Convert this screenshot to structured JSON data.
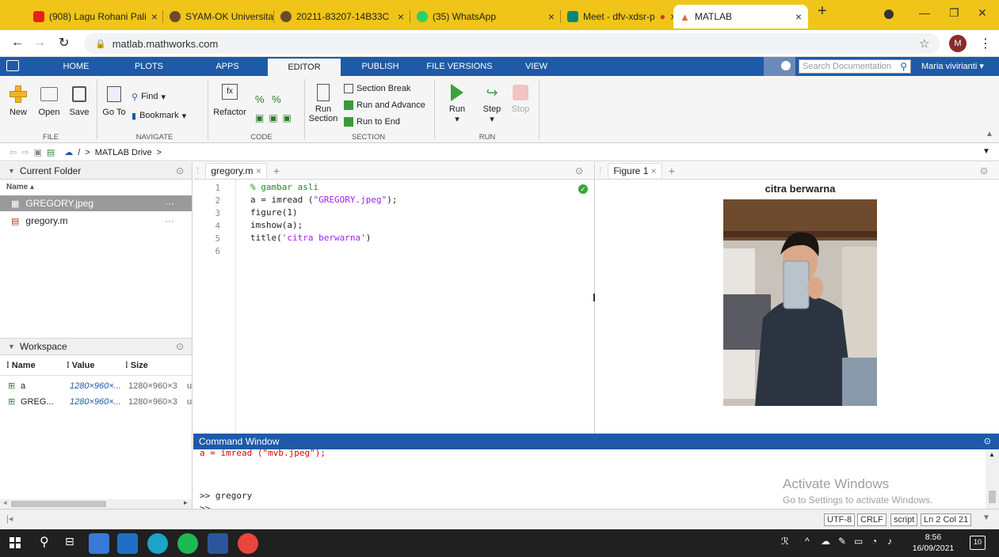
{
  "browser": {
    "tabs": [
      {
        "label": "(908) Lagu Rohani Pali",
        "fav_color": "#e62117"
      },
      {
        "label": "SYAM-OK Universitas",
        "fav_color": "#6b4c2a"
      },
      {
        "label": "20211-83207-14B33C",
        "fav_color": "#6b4c2a"
      },
      {
        "label": "(35) WhatsApp",
        "fav_color": "#25d366"
      },
      {
        "label": "Meet - dfv-xdsr-p",
        "fav_color": "#00897b"
      },
      {
        "label": "MATLAB",
        "fav_color": "#e16737"
      }
    ],
    "new_tab": "+",
    "url": "matlab.mathworks.com",
    "profile_initial": "M"
  },
  "matlab_tabs": [
    "HOME",
    "PLOTS",
    "APPS",
    "EDITOR",
    "PUBLISH",
    "FILE VERSIONS",
    "VIEW"
  ],
  "search_placeholder": "Search Documentation",
  "user_name": "Maria vivirianti",
  "ribbon": {
    "file": {
      "new": "New",
      "open": "Open",
      "save": "Save",
      "group": "FILE"
    },
    "navigate": {
      "goto": "Go To",
      "find": "Find",
      "bookmark": "Bookmark",
      "group": "NAVIGATE"
    },
    "code": {
      "refactor": "Refactor",
      "group": "CODE"
    },
    "section": {
      "run_section": "Run",
      "run_section2": "Section",
      "section_break": "Section Break",
      "run_advance": "Run and Advance",
      "run_to_end": "Run to End",
      "group": "SECTION"
    },
    "run": {
      "run": "Run",
      "step": "Step",
      "stop": "Stop",
      "group": "RUN"
    }
  },
  "path": {
    "sep": "/",
    "folder": "MATLAB Drive",
    "arrow": ">"
  },
  "current_folder": {
    "title": "Current Folder",
    "name_col": "Name",
    "files": [
      "GREGORY.jpeg",
      "gregory.m"
    ]
  },
  "workspace": {
    "title": "Workspace",
    "cols": [
      "Name",
      "Value",
      "Size"
    ],
    "rows": [
      {
        "name": "a",
        "value": "1280×960×...",
        "size": "1280×960×3",
        "class": "u"
      },
      {
        "name": "GREG...",
        "value": "1280×960×...",
        "size": "1280×960×3",
        "class": "u"
      }
    ]
  },
  "editor": {
    "tab": "gregory.m",
    "line_numbers": [
      "1",
      "2",
      "3",
      "4",
      "5",
      "6"
    ],
    "lines": [
      {
        "a": "% gambar asli",
        "b": "",
        "c": ""
      },
      {
        "a": "a = imread (",
        "b": "\"GREGORY.jpeg\"",
        "c": ");"
      },
      {
        "a": "figure(1)",
        "b": "",
        "c": ""
      },
      {
        "a": "imshow(a);",
        "b": "",
        "c": ""
      },
      {
        "a": "title(",
        "b": "'citra berwarna'",
        "c": ")"
      }
    ]
  },
  "figure": {
    "tab": "Figure 1",
    "title": "citra berwarna"
  },
  "command_window": {
    "title": "Command Window",
    "error_line": "a = imread (\"mvb.jpeg\");",
    "line1": ">> gregory",
    "prompt": ">>"
  },
  "watermark": {
    "title": "Activate Windows",
    "sub": "Go to Settings to activate Windows."
  },
  "status": {
    "enc": "UTF-8",
    "eol": "CRLF",
    "type": "script",
    "pos": "Ln 2 Col 21"
  },
  "taskbar": {
    "time": "8:56",
    "date": "16/09/2021",
    "notif": "10"
  }
}
